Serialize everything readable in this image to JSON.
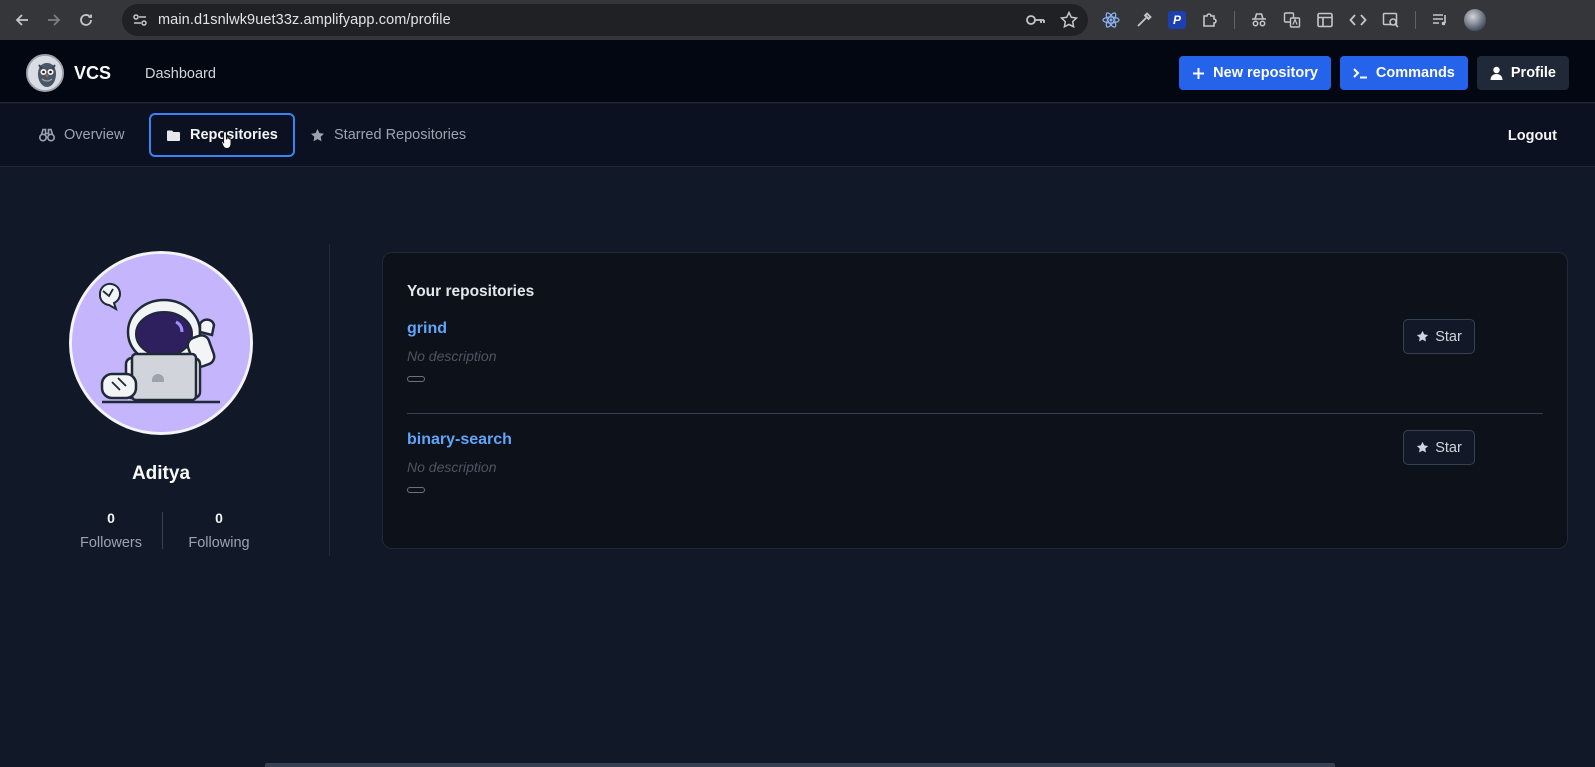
{
  "browser": {
    "url": "main.d1snlwk9uet33z.amplifyapp.com/profile"
  },
  "header": {
    "brand": "VCS",
    "dashboard_link": "Dashboard",
    "new_repo_label": "New repository",
    "commands_label": "Commands",
    "profile_label": "Profile"
  },
  "tabs": [
    {
      "label": "Overview",
      "icon": "binoculars-icon"
    },
    {
      "label": "Repositories",
      "icon": "folder-icon",
      "active": true
    },
    {
      "label": "Starred Repositories",
      "icon": "star-icon"
    }
  ],
  "logout_label": "Logout",
  "profile": {
    "username": "Aditya",
    "followers": {
      "count": "0",
      "label": "Followers"
    },
    "following": {
      "count": "0",
      "label": "Following"
    }
  },
  "repositories": {
    "title": "Your repositories",
    "items": [
      {
        "name": "grind",
        "description": "No description",
        "star_label": "Star"
      },
      {
        "name": "binary-search",
        "description": "No description",
        "star_label": "Star"
      }
    ]
  },
  "colors": {
    "accent": "#2563eb",
    "repo_link": "#60a5fa",
    "page_bg": "#111827"
  }
}
